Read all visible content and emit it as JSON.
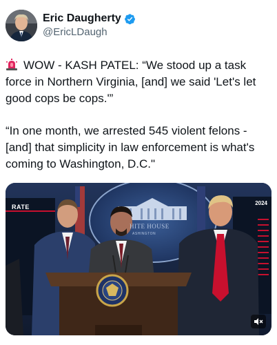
{
  "author": {
    "display_name": "Eric Daugherty",
    "handle": "@EricLDaugh",
    "verified": true,
    "avatar_icon": "profile-photo"
  },
  "post": {
    "paragraph_1": "WOW - KASH PATEL: “We stood up a task force in Northern Virginia, [and] we said 'Let's let good cops be cops.'”",
    "paragraph_2": "“In one month, we arrested 545 violent felons - [and] that simplicity in law enforcement is what's coming to Washington, D.C.\"",
    "leading_emoji": "siren-icon"
  },
  "media": {
    "type": "video",
    "screen_left_text": "RATE",
    "screen_right_text": "2024",
    "backdrop_text_1": "HITE HOUSE",
    "backdrop_text_2": "ASHINGTON",
    "mute_icon": "muted-speaker-icon"
  },
  "colors": {
    "verified_badge": "#1d9bf0",
    "handle": "#536471",
    "text": "#0f1419"
  }
}
